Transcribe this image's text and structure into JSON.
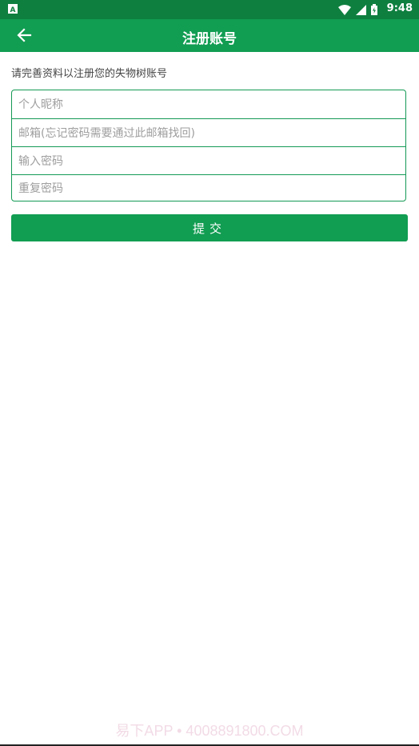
{
  "status_bar": {
    "time": "9:48"
  },
  "app_bar": {
    "title": "注册账号"
  },
  "intro_text": "请完善资料以注册您的失物树账号",
  "form": {
    "nickname": {
      "placeholder": "个人昵称",
      "value": ""
    },
    "email": {
      "placeholder": "邮箱(忘记密码需要通过此邮箱找回)",
      "value": ""
    },
    "password": {
      "placeholder": "输入密码",
      "value": ""
    },
    "password_repeat": {
      "placeholder": "重复密码",
      "value": ""
    }
  },
  "submit_label": "提交",
  "watermark": "易下APP • 4008891800.COM",
  "colors": {
    "primary": "#119d52",
    "status": "#0e7f3f",
    "border": "#149a55"
  }
}
